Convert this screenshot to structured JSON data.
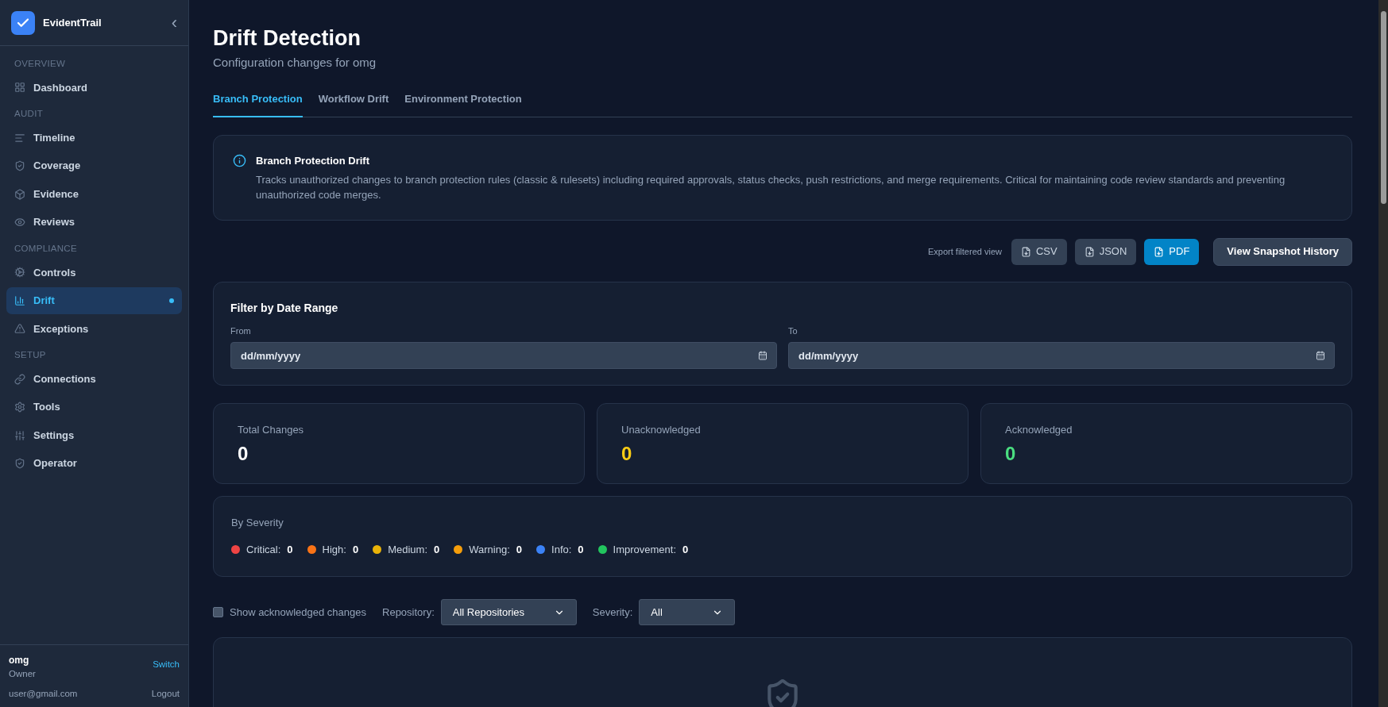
{
  "sidebar": {
    "brand": "EvidentTrail",
    "collapse": "‹",
    "sections": [
      {
        "title": "OVERVIEW",
        "items": [
          {
            "label": "Dashboard",
            "selected": false
          }
        ]
      },
      {
        "title": "AUDIT",
        "items": [
          {
            "label": "Timeline",
            "selected": false
          },
          {
            "label": "Coverage",
            "selected": false
          },
          {
            "label": "Evidence",
            "selected": false
          },
          {
            "label": "Reviews",
            "selected": false
          }
        ]
      },
      {
        "title": "COMPLIANCE",
        "items": [
          {
            "label": "Controls",
            "selected": false
          },
          {
            "label": "Drift",
            "selected": true
          },
          {
            "label": "Exceptions",
            "selected": false
          }
        ]
      },
      {
        "title": "SETUP",
        "items": [
          {
            "label": "Connections",
            "selected": false
          },
          {
            "label": "Tools",
            "selected": false
          },
          {
            "label": "Settings",
            "selected": false
          },
          {
            "label": "Operator",
            "selected": false
          }
        ]
      }
    ],
    "user": {
      "name": "omg",
      "role": "Owner",
      "email": "user@gmail.com",
      "switch": "Switch",
      "logout": "Logout"
    }
  },
  "page": {
    "title": "Drift Detection",
    "subtitle": "Configuration changes for omg"
  },
  "tabs": [
    {
      "label": "Branch Protection",
      "selected": true
    },
    {
      "label": "Workflow Drift",
      "selected": false
    },
    {
      "label": "Environment Protection",
      "selected": false
    }
  ],
  "info": {
    "title": "Branch Protection Drift",
    "text": "Tracks unauthorized changes to branch protection rules (classic & rulesets) including required approvals, status checks, push restrictions, and merge requirements. Critical for maintaining code review standards and preventing unauthorized code merges."
  },
  "export": {
    "label": "Export filtered view",
    "buttons": [
      {
        "label": "CSV",
        "selected": false
      },
      {
        "label": "JSON",
        "selected": false
      },
      {
        "label": "PDF",
        "selected": true
      }
    ],
    "history": "View Snapshot History"
  },
  "date_filter": {
    "title": "Filter by Date Range",
    "fields": [
      {
        "label": "From",
        "placeholder": "dd/mm/yyyy"
      },
      {
        "label": "To",
        "placeholder": "dd/mm/yyyy"
      }
    ]
  },
  "stats": [
    {
      "label": "Total Changes",
      "value": "0",
      "color": "#ffffff"
    },
    {
      "label": "Unacknowledged",
      "value": "0",
      "color": "#facc15"
    },
    {
      "label": "Acknowledged",
      "value": "0",
      "color": "#4ade80"
    }
  ],
  "severity": {
    "title": "By Severity",
    "items": [
      {
        "label": "Critical:",
        "count": "0",
        "color": "#ef4444"
      },
      {
        "label": "High:",
        "count": "0",
        "color": "#f97316"
      },
      {
        "label": "Medium:",
        "count": "0",
        "color": "#eab308"
      },
      {
        "label": "Warning:",
        "count": "0",
        "color": "#f59e0b"
      },
      {
        "label": "Info:",
        "count": "0",
        "color": "#3b82f6"
      },
      {
        "label": "Improvement:",
        "count": "0",
        "color": "#22c55e"
      }
    ]
  },
  "filters": {
    "show_acknowledged": {
      "label": "Show acknowledged changes",
      "checked": false
    },
    "repository": {
      "label": "Repository:",
      "value": "All Repositories"
    },
    "severity": {
      "label": "Severity:",
      "value": "All"
    }
  }
}
